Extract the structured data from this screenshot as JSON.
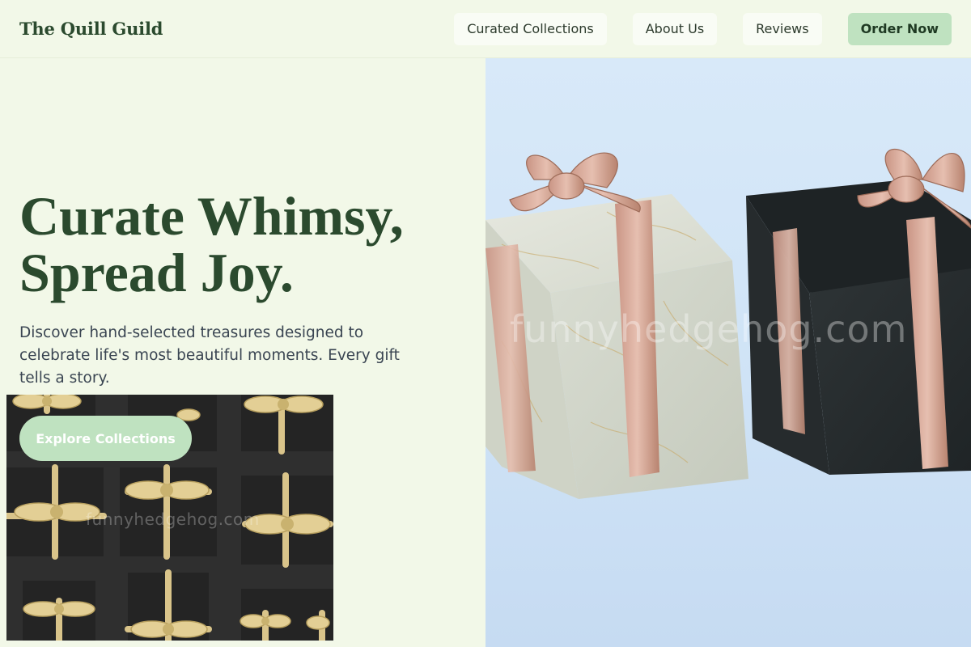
{
  "header": {
    "brand": "The Quill Guild",
    "nav": [
      {
        "label": "Curated Collections"
      },
      {
        "label": "About Us"
      },
      {
        "label": "Reviews"
      }
    ],
    "order_label": "Order Now"
  },
  "hero": {
    "title_line1": "Curate Whimsy,",
    "title_line2": "Spread Joy.",
    "subtitle": "Discover hand-selected treasures designed to celebrate life's most beautiful moments. Every gift tells a story.",
    "cta_label": "Explore Collections",
    "watermark": "funnyhedgehog.com"
  },
  "colors": {
    "background": "#f2f8e8",
    "accent": "#bfe2c0",
    "heading": "#2b4a2e"
  }
}
